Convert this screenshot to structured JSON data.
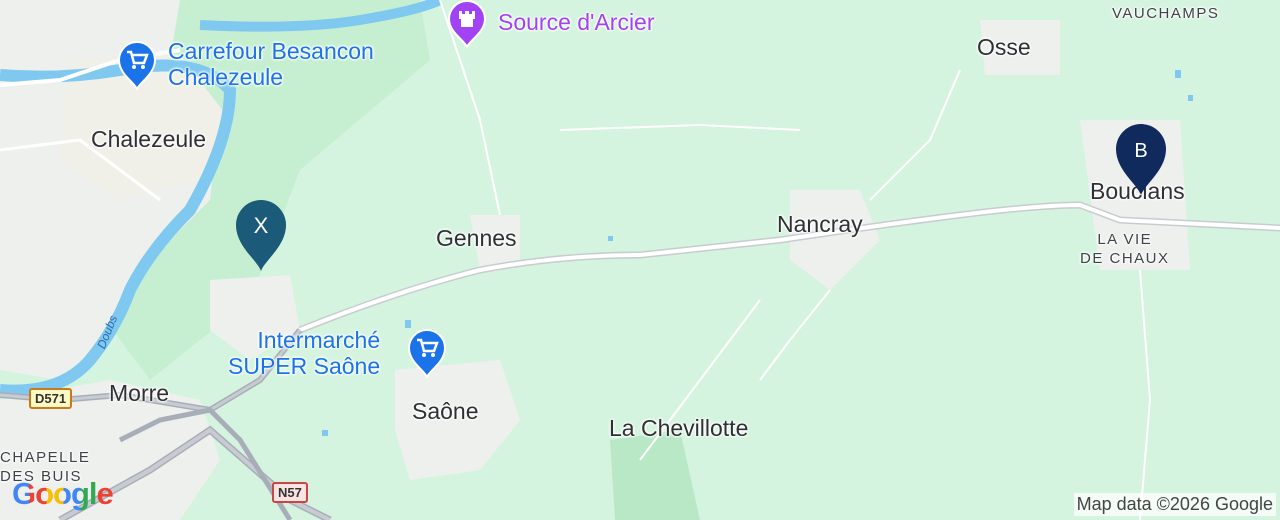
{
  "map": {
    "towns": {
      "vauchamps": "VAUCHAMPS",
      "osse": "Osse",
      "chalezeule": "Chalezeule",
      "gennes": "Gennes",
      "nancray": "Nancray",
      "bouclans": "Bouclans",
      "la_vie_de_chaux_line1": "LA VIE",
      "la_vie_de_chaux_line2": "DE CHAUX",
      "morre": "Morre",
      "saone": "Saône",
      "la_chevillotte": "La Chevillotte",
      "chapelle_line1": "CHAPELLE",
      "chapelle_line2": "DES BUIS"
    },
    "pois": {
      "source_arcier": "Source d'Arcier",
      "carrefour_line1": "Carrefour Besancon",
      "carrefour_line2": "Chalezeule",
      "intermarche_line1": "Intermarché",
      "intermarche_line2": "SUPER Saône"
    },
    "roads": {
      "d571": "D571",
      "n57": "N57"
    },
    "river": "Doubs",
    "markers": {
      "x_label": "X",
      "b_label": "B"
    },
    "logo": "Google",
    "attribution": "Map data ©2026 Google",
    "colors": {
      "land": "#d4f4df",
      "urban": "#eef0ee",
      "water": "#7fc8f0",
      "marker_x": "#1b5a78",
      "marker_b": "#102a5e",
      "poi_blue": "#1a73e8",
      "poi_purple": "#a142f4"
    }
  }
}
